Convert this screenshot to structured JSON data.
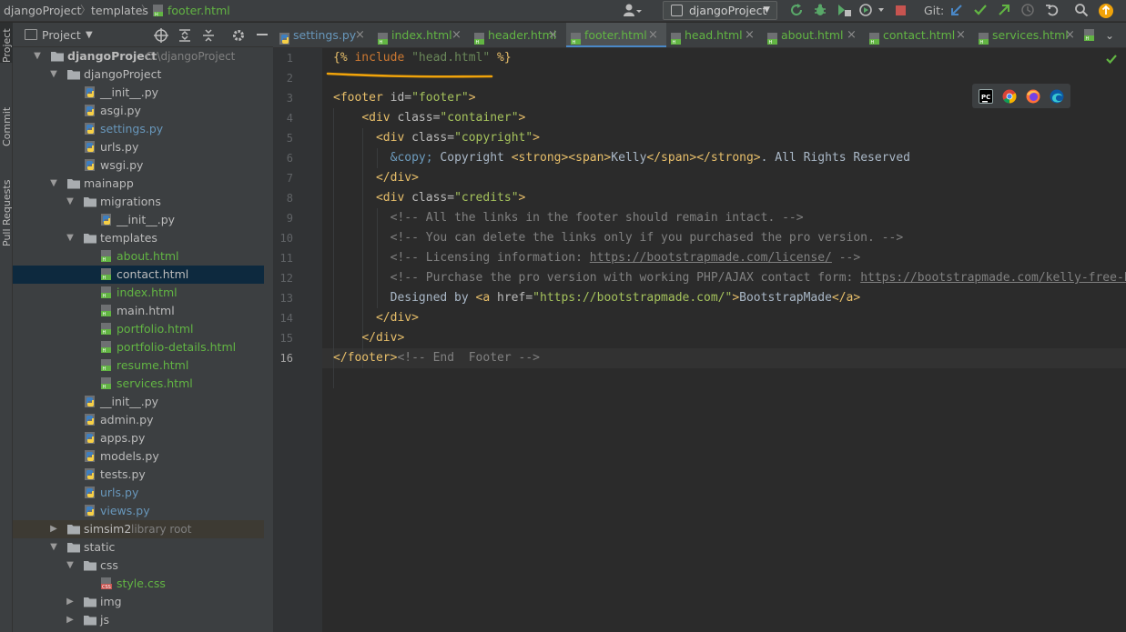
{
  "breadcrumb": {
    "project": "djangoProject",
    "folder": "templates",
    "file": "footer.html"
  },
  "toolbar": {
    "run_config_label": "djangoProject",
    "git_label": "Git:"
  },
  "left_strip": {
    "project_tab": "Project",
    "commit_tab": "Commit",
    "pull_requests_tab": "Pull Requests"
  },
  "project_panel": {
    "view_label": "Project",
    "tree": [
      {
        "label": "djangoProject",
        "extra": "C:\\djangoProject",
        "type": "root",
        "level": 0,
        "expanded": true
      },
      {
        "label": "djangoProject",
        "type": "folder",
        "level": 1,
        "expanded": true
      },
      {
        "label": "__init__.py",
        "type": "py",
        "level": 2,
        "color": "default"
      },
      {
        "label": "asgi.py",
        "type": "py",
        "level": 2,
        "color": "default"
      },
      {
        "label": "settings.py",
        "type": "py",
        "level": 2,
        "color": "blue"
      },
      {
        "label": "urls.py",
        "type": "py",
        "level": 2,
        "color": "default"
      },
      {
        "label": "wsgi.py",
        "type": "py",
        "level": 2,
        "color": "default"
      },
      {
        "label": "mainapp",
        "type": "folder",
        "level": 1,
        "expanded": true
      },
      {
        "label": "migrations",
        "type": "folder",
        "level": 2,
        "expanded": true
      },
      {
        "label": "__init__.py",
        "type": "py",
        "level": 3,
        "color": "default"
      },
      {
        "label": "templates",
        "type": "folder",
        "level": 2,
        "expanded": true
      },
      {
        "label": "about.html",
        "type": "html",
        "level": 3,
        "color": "green"
      },
      {
        "label": "contact.html",
        "type": "html",
        "level": 3,
        "color": "default",
        "selected": true
      },
      {
        "label": "index.html",
        "type": "html",
        "level": 3,
        "color": "green"
      },
      {
        "label": "main.html",
        "type": "html",
        "level": 3,
        "color": "default"
      },
      {
        "label": "portfolio.html",
        "type": "html",
        "level": 3,
        "color": "green"
      },
      {
        "label": "portfolio-details.html",
        "type": "html",
        "level": 3,
        "color": "green"
      },
      {
        "label": "resume.html",
        "type": "html",
        "level": 3,
        "color": "green"
      },
      {
        "label": "services.html",
        "type": "html",
        "level": 3,
        "color": "green"
      },
      {
        "label": "__init__.py",
        "type": "py",
        "level": 2,
        "color": "default"
      },
      {
        "label": "admin.py",
        "type": "py",
        "level": 2,
        "color": "default"
      },
      {
        "label": "apps.py",
        "type": "py",
        "level": 2,
        "color": "default"
      },
      {
        "label": "models.py",
        "type": "py",
        "level": 2,
        "color": "default"
      },
      {
        "label": "tests.py",
        "type": "py",
        "level": 2,
        "color": "default"
      },
      {
        "label": "urls.py",
        "type": "py",
        "level": 2,
        "color": "blue"
      },
      {
        "label": "views.py",
        "type": "py",
        "level": 2,
        "color": "blue"
      },
      {
        "label": "simsim2",
        "extra": "library root",
        "type": "folder",
        "level": 1,
        "expanded": false,
        "libroot": true
      },
      {
        "label": "static",
        "type": "folder",
        "level": 1,
        "expanded": true
      },
      {
        "label": "css",
        "type": "folder",
        "level": 2,
        "expanded": true
      },
      {
        "label": "style.css",
        "type": "css",
        "level": 3,
        "color": "green"
      },
      {
        "label": "img",
        "type": "folder",
        "level": 2,
        "expanded": false
      },
      {
        "label": "js",
        "type": "folder",
        "level": 2,
        "expanded": false
      }
    ]
  },
  "tabs": [
    {
      "label": "settings.py",
      "kind": "py",
      "color": "blue"
    },
    {
      "label": "index.html",
      "kind": "html",
      "color": "green"
    },
    {
      "label": "header.html",
      "kind": "html",
      "color": "green"
    },
    {
      "label": "footer.html",
      "kind": "html",
      "color": "green",
      "active": true
    },
    {
      "label": "head.html",
      "kind": "html",
      "color": "green"
    },
    {
      "label": "about.html",
      "kind": "html",
      "color": "green"
    },
    {
      "label": "contact.html",
      "kind": "html",
      "color": "green"
    },
    {
      "label": "services.html",
      "kind": "html",
      "color": "green"
    }
  ],
  "editor": {
    "current_line": 16,
    "lines": [
      [
        [
          "t-tmpl",
          "{% "
        ],
        [
          "t-kw",
          "include"
        ],
        [
          "t-plain",
          " "
        ],
        [
          "t-tstr",
          "\"head.html\""
        ],
        [
          "t-plain",
          " "
        ],
        [
          "t-tmpl",
          "%}"
        ]
      ],
      [],
      [
        [
          "t-tag",
          "<footer"
        ],
        [
          "t-attr",
          " id="
        ],
        [
          "t-str",
          "\"footer\""
        ],
        [
          "t-tag",
          ">"
        ]
      ],
      [
        [
          "t-plain",
          "    "
        ],
        [
          "t-tag",
          "<div"
        ],
        [
          "t-attr",
          " class="
        ],
        [
          "t-str",
          "\"container\""
        ],
        [
          "t-tag",
          ">"
        ]
      ],
      [
        [
          "t-plain",
          "      "
        ],
        [
          "t-tag",
          "<div"
        ],
        [
          "t-attr",
          " class="
        ],
        [
          "t-str",
          "\"copyright\""
        ],
        [
          "t-tag",
          ">"
        ]
      ],
      [
        [
          "t-plain",
          "        "
        ],
        [
          "t-ent",
          "&copy;"
        ],
        [
          "t-plain",
          " Copyright "
        ],
        [
          "t-tag",
          "<strong><span>"
        ],
        [
          "t-plain",
          "Kelly"
        ],
        [
          "t-tag",
          "</span></strong>"
        ],
        [
          "t-plain",
          ". All Rights Reserved"
        ]
      ],
      [
        [
          "t-plain",
          "      "
        ],
        [
          "t-tag",
          "</div>"
        ]
      ],
      [
        [
          "t-plain",
          "      "
        ],
        [
          "t-tag",
          "<div"
        ],
        [
          "t-attr",
          " class="
        ],
        [
          "t-str",
          "\"credits\""
        ],
        [
          "t-tag",
          ">"
        ]
      ],
      [
        [
          "t-plain",
          "        "
        ],
        [
          "t-cmt",
          "<!-- All the links in the footer should remain intact. -->"
        ]
      ],
      [
        [
          "t-plain",
          "        "
        ],
        [
          "t-cmt",
          "<!-- You can delete the links only if you purchased the pro version. -->"
        ]
      ],
      [
        [
          "t-plain",
          "        "
        ],
        [
          "t-cmt",
          "<!-- Licensing information: "
        ],
        [
          "t-link",
          "https://bootstrapmade.com/license/"
        ],
        [
          "t-cmt",
          " -->"
        ]
      ],
      [
        [
          "t-plain",
          "        "
        ],
        [
          "t-cmt",
          "<!-- Purchase the pro version with working PHP/AJAX contact form: "
        ],
        [
          "t-link",
          "https://bootstrapmade.com/kelly-free-bootstrap-cv-resume-html-template/"
        ],
        [
          "t-cmt",
          " -->"
        ]
      ],
      [
        [
          "t-plain",
          "        Designed by "
        ],
        [
          "t-tag",
          "<a"
        ],
        [
          "t-attr",
          " href="
        ],
        [
          "t-str",
          "\"https://bootstrapmade.com/\""
        ],
        [
          "t-tag",
          ">"
        ],
        [
          "t-plain",
          "BootstrapMade"
        ],
        [
          "t-tag",
          "</a>"
        ]
      ],
      [
        [
          "t-plain",
          "      "
        ],
        [
          "t-tag",
          "</div>"
        ]
      ],
      [
        [
          "t-plain",
          "    "
        ],
        [
          "t-tag",
          "</div>"
        ]
      ],
      [
        [
          "t-tag",
          "</footer>"
        ],
        [
          "t-cmt",
          "<!-- End  Footer -->"
        ]
      ]
    ]
  },
  "colors": {
    "accent": "#4a88c7",
    "annotation": "#f0a30a",
    "check": "#62b543"
  }
}
